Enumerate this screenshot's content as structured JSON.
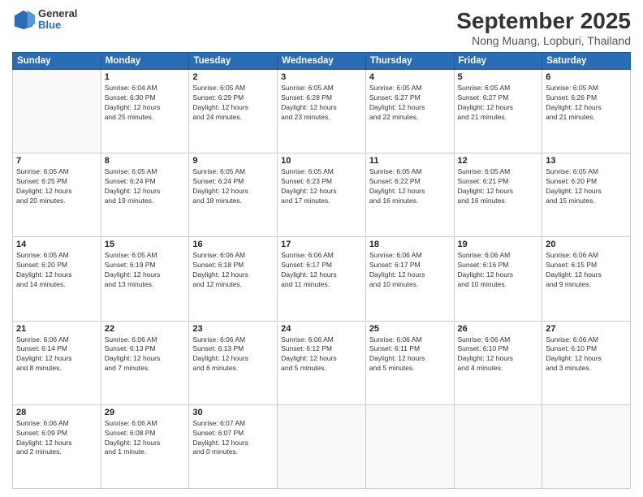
{
  "logo": {
    "general": "General",
    "blue": "Blue"
  },
  "header": {
    "month": "September 2025",
    "location": "Nong Muang, Lopburi, Thailand"
  },
  "weekdays": [
    "Sunday",
    "Monday",
    "Tuesday",
    "Wednesday",
    "Thursday",
    "Friday",
    "Saturday"
  ],
  "weeks": [
    [
      {
        "day": "",
        "info": ""
      },
      {
        "day": "1",
        "info": "Sunrise: 6:04 AM\nSunset: 6:30 PM\nDaylight: 12 hours\nand 25 minutes."
      },
      {
        "day": "2",
        "info": "Sunrise: 6:05 AM\nSunset: 6:29 PM\nDaylight: 12 hours\nand 24 minutes."
      },
      {
        "day": "3",
        "info": "Sunrise: 6:05 AM\nSunset: 6:28 PM\nDaylight: 12 hours\nand 23 minutes."
      },
      {
        "day": "4",
        "info": "Sunrise: 6:05 AM\nSunset: 6:27 PM\nDaylight: 12 hours\nand 22 minutes."
      },
      {
        "day": "5",
        "info": "Sunrise: 6:05 AM\nSunset: 6:27 PM\nDaylight: 12 hours\nand 21 minutes."
      },
      {
        "day": "6",
        "info": "Sunrise: 6:05 AM\nSunset: 6:26 PM\nDaylight: 12 hours\nand 21 minutes."
      }
    ],
    [
      {
        "day": "7",
        "info": "Sunrise: 6:05 AM\nSunset: 6:25 PM\nDaylight: 12 hours\nand 20 minutes."
      },
      {
        "day": "8",
        "info": "Sunrise: 6:05 AM\nSunset: 6:24 PM\nDaylight: 12 hours\nand 19 minutes."
      },
      {
        "day": "9",
        "info": "Sunrise: 6:05 AM\nSunset: 6:24 PM\nDaylight: 12 hours\nand 18 minutes."
      },
      {
        "day": "10",
        "info": "Sunrise: 6:05 AM\nSunset: 6:23 PM\nDaylight: 12 hours\nand 17 minutes."
      },
      {
        "day": "11",
        "info": "Sunrise: 6:05 AM\nSunset: 6:22 PM\nDaylight: 12 hours\nand 16 minutes."
      },
      {
        "day": "12",
        "info": "Sunrise: 6:05 AM\nSunset: 6:21 PM\nDaylight: 12 hours\nand 16 minutes."
      },
      {
        "day": "13",
        "info": "Sunrise: 6:05 AM\nSunset: 6:20 PM\nDaylight: 12 hours\nand 15 minutes."
      }
    ],
    [
      {
        "day": "14",
        "info": "Sunrise: 6:05 AM\nSunset: 6:20 PM\nDaylight: 12 hours\nand 14 minutes."
      },
      {
        "day": "15",
        "info": "Sunrise: 6:05 AM\nSunset: 6:19 PM\nDaylight: 12 hours\nand 13 minutes."
      },
      {
        "day": "16",
        "info": "Sunrise: 6:06 AM\nSunset: 6:18 PM\nDaylight: 12 hours\nand 12 minutes."
      },
      {
        "day": "17",
        "info": "Sunrise: 6:06 AM\nSunset: 6:17 PM\nDaylight: 12 hours\nand 11 minutes."
      },
      {
        "day": "18",
        "info": "Sunrise: 6:06 AM\nSunset: 6:17 PM\nDaylight: 12 hours\nand 10 minutes."
      },
      {
        "day": "19",
        "info": "Sunrise: 6:06 AM\nSunset: 6:16 PM\nDaylight: 12 hours\nand 10 minutes."
      },
      {
        "day": "20",
        "info": "Sunrise: 6:06 AM\nSunset: 6:15 PM\nDaylight: 12 hours\nand 9 minutes."
      }
    ],
    [
      {
        "day": "21",
        "info": "Sunrise: 6:06 AM\nSunset: 6:14 PM\nDaylight: 12 hours\nand 8 minutes."
      },
      {
        "day": "22",
        "info": "Sunrise: 6:06 AM\nSunset: 6:13 PM\nDaylight: 12 hours\nand 7 minutes."
      },
      {
        "day": "23",
        "info": "Sunrise: 6:06 AM\nSunset: 6:13 PM\nDaylight: 12 hours\nand 6 minutes."
      },
      {
        "day": "24",
        "info": "Sunrise: 6:06 AM\nSunset: 6:12 PM\nDaylight: 12 hours\nand 5 minutes."
      },
      {
        "day": "25",
        "info": "Sunrise: 6:06 AM\nSunset: 6:11 PM\nDaylight: 12 hours\nand 5 minutes."
      },
      {
        "day": "26",
        "info": "Sunrise: 6:06 AM\nSunset: 6:10 PM\nDaylight: 12 hours\nand 4 minutes."
      },
      {
        "day": "27",
        "info": "Sunrise: 6:06 AM\nSunset: 6:10 PM\nDaylight: 12 hours\nand 3 minutes."
      }
    ],
    [
      {
        "day": "28",
        "info": "Sunrise: 6:06 AM\nSunset: 6:09 PM\nDaylight: 12 hours\nand 2 minutes."
      },
      {
        "day": "29",
        "info": "Sunrise: 6:06 AM\nSunset: 6:08 PM\nDaylight: 12 hours\nand 1 minute."
      },
      {
        "day": "30",
        "info": "Sunrise: 6:07 AM\nSunset: 6:07 PM\nDaylight: 12 hours\nand 0 minutes."
      },
      {
        "day": "",
        "info": ""
      },
      {
        "day": "",
        "info": ""
      },
      {
        "day": "",
        "info": ""
      },
      {
        "day": "",
        "info": ""
      }
    ]
  ]
}
